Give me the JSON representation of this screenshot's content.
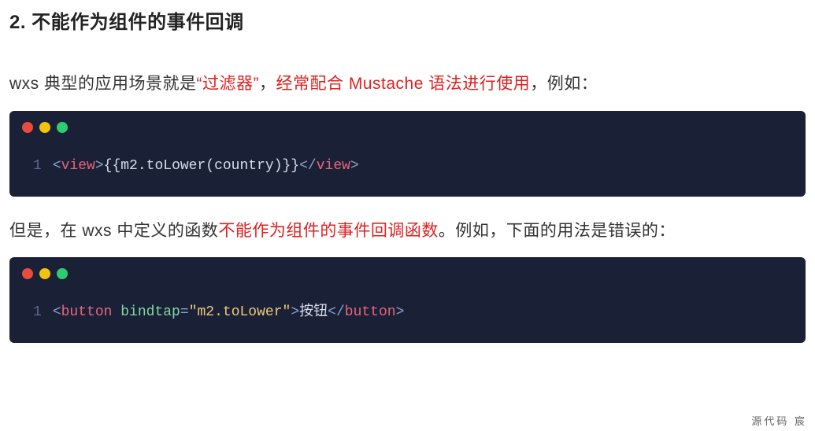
{
  "heading": "2. 不能作为组件的事件回调",
  "para1": {
    "p1": "wxs 典型的应用场景就是",
    "q_open": "“",
    "filter": "过滤器",
    "q_close": "”",
    "comma1": "，",
    "often": "经常配合 Mustache 语法进行使用",
    "tail": "，例如："
  },
  "code1": {
    "ln": "1",
    "lt": "<",
    "tag_open": "view",
    "gt": ">",
    "expr": "{{m2.toLower(country)}}",
    "lt2": "</",
    "tag_close": "view",
    "gt2": ">"
  },
  "para2": {
    "p1": "但是，在 wxs 中定义的函数",
    "red": "不能作为组件的事件回调函数",
    "p2": "。例如，下面的用法是错误的："
  },
  "code2": {
    "ln": "1",
    "lt": "<",
    "tag_open": "button",
    "sp": " ",
    "attr": "bindtap",
    "eq": "=",
    "q1": "\"",
    "str": "m2.toLower",
    "q2": "\"",
    "gt": ">",
    "text": "按钮",
    "lt2": "</",
    "tag_close": "button",
    "gt2": ">"
  },
  "watermark": "源代码  宸"
}
